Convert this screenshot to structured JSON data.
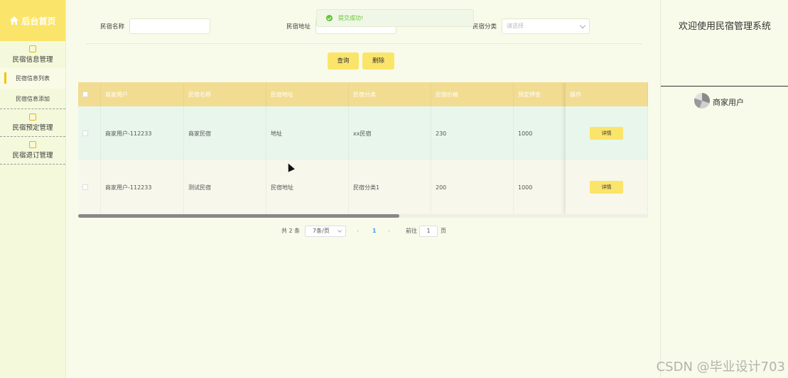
{
  "sidebar": {
    "logo": "后台首页",
    "groups": [
      {
        "label": "民宿信息管理",
        "items": [
          "民宿信息列表",
          "民宿信息添加"
        ]
      },
      {
        "label": "民宿预定管理"
      },
      {
        "label": "民宿退订管理"
      }
    ]
  },
  "toast": {
    "message": "提交成功!"
  },
  "search": {
    "name_label": "民宿名称",
    "address_label": "民宿地址",
    "category_label": "民宿分类",
    "category_placeholder": "请选择",
    "query_button": "查询",
    "delete_button": "删除"
  },
  "table": {
    "headers": [
      "商家用户",
      "民宿名称",
      "民宿地址",
      "民宿分类",
      "民宿价格",
      "预定押金",
      "操作"
    ],
    "rows": [
      {
        "user": "商家用户-112233",
        "name": "商家民宿",
        "address": "地址",
        "category": "xx民宿",
        "price": "230",
        "deposit": "1000",
        "action": "详情"
      },
      {
        "user": "商家用户-112233",
        "name": "测试民宿",
        "address": "民宿地址",
        "category": "民宿分类1",
        "price": "200",
        "deposit": "1000",
        "action": "详情"
      }
    ]
  },
  "pagination": {
    "total": "共 2 条",
    "page_size": "7条/页",
    "current": "1",
    "goto_label": "前往",
    "goto_value": "1",
    "page_suffix": "页"
  },
  "right_panel": {
    "welcome": "欢迎使用民宿管理系统",
    "user": "商家用户"
  },
  "watermark": "CSDN @毕业设计703",
  "colors": {
    "accent": "#fbe46a",
    "header": "#f1dc92",
    "success": "#67c23a"
  }
}
